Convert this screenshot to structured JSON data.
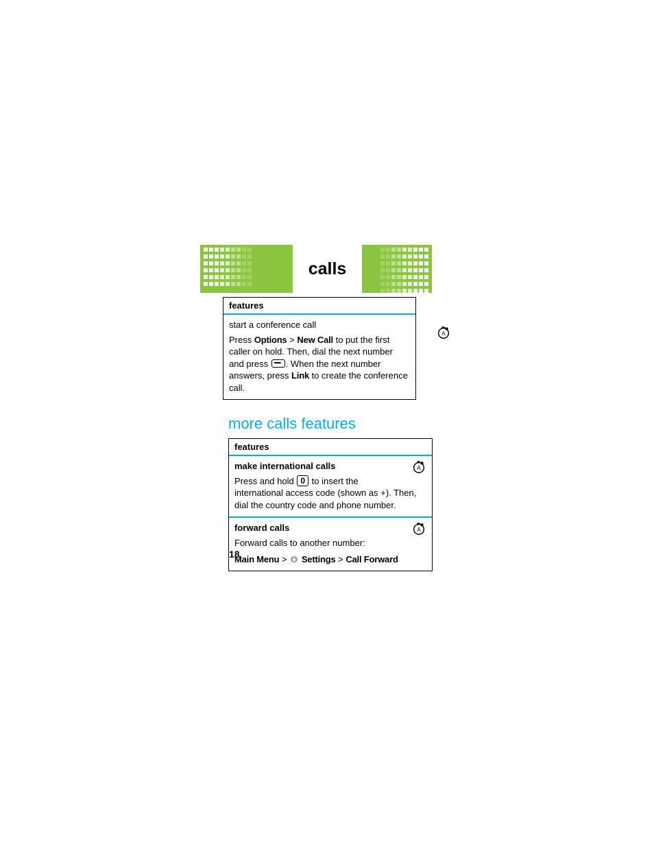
{
  "banner": {
    "title": "calls"
  },
  "table1": {
    "header": "features",
    "row_title": "start a conference call",
    "body_pre": "Press ",
    "options": "Options",
    "gt1": " > ",
    "newcall": "New Call",
    "body_mid1": " to put the first caller on hold. Then, dial the next number and press ",
    "body_mid2": ". When the next number answers, press ",
    "link": "Link",
    "body_end": " to create the conference call."
  },
  "more_heading": "more calls features",
  "table2": {
    "header": "features",
    "rowA_title": "make international calls",
    "rowA_pre": "Press and hold ",
    "rowA_key": "0",
    "rowA_post": " to insert the international access code (shown as +). Then, dial the country code and phone number.",
    "rowB_title": "forward calls",
    "rowB_desc": "Forward calls to another number:",
    "rowB_path_main": "Main Menu",
    "rowB_gt1": " > ",
    "rowB_settings": "Settings",
    "rowB_gt2": " > ",
    "rowB_callfwd": "Call Forward"
  },
  "page_number": "18"
}
